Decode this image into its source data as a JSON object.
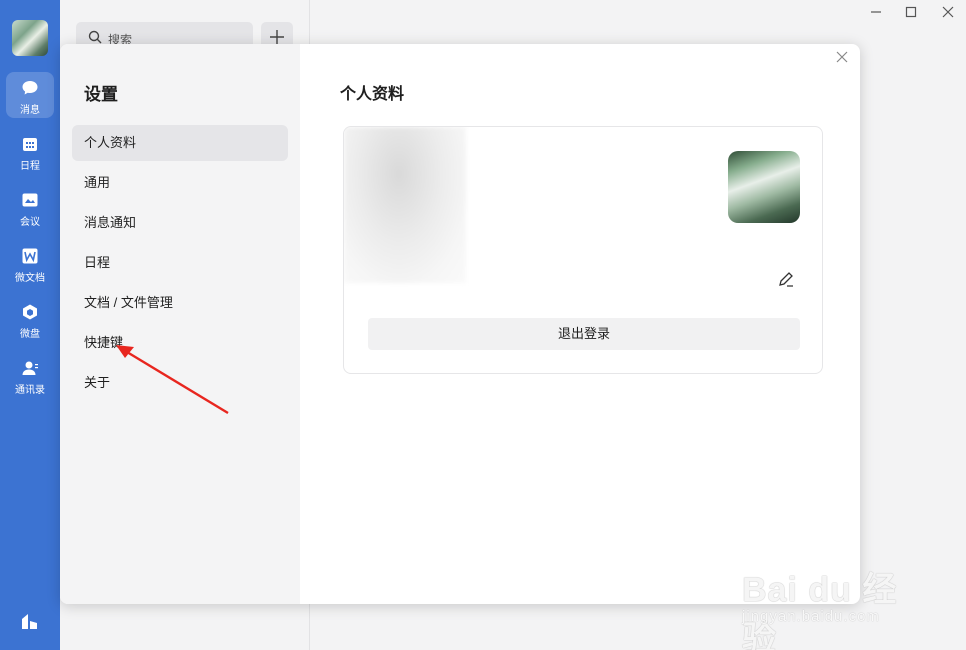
{
  "rail": {
    "items": [
      {
        "label": "消息",
        "icon": "chat-bubble-icon",
        "active": true
      },
      {
        "label": "日程",
        "icon": "calendar-icon",
        "active": false
      },
      {
        "label": "会议",
        "icon": "meeting-icon",
        "active": false
      },
      {
        "label": "微文档",
        "icon": "doc-w-icon",
        "active": false
      },
      {
        "label": "微盘",
        "icon": "drive-icon",
        "active": false
      },
      {
        "label": "通讯录",
        "icon": "contacts-icon",
        "active": false
      }
    ],
    "accent": "#3c73d2"
  },
  "list": {
    "search_placeholder": "搜索"
  },
  "settings": {
    "title": "设置",
    "menu": [
      {
        "label": "个人资料",
        "active": true
      },
      {
        "label": "通用",
        "active": false
      },
      {
        "label": "消息通知",
        "active": false
      },
      {
        "label": "日程",
        "active": false
      },
      {
        "label": "文档 / 文件管理",
        "active": false
      },
      {
        "label": "快捷键",
        "active": false
      },
      {
        "label": "关于",
        "active": false
      }
    ],
    "section_title": "个人资料",
    "logout_label": "退出登录"
  },
  "annotation": {
    "arrow_color": "#e8261f"
  },
  "watermark": {
    "brand": "Bai du 经验",
    "url": "jingyan.baidu.com"
  }
}
